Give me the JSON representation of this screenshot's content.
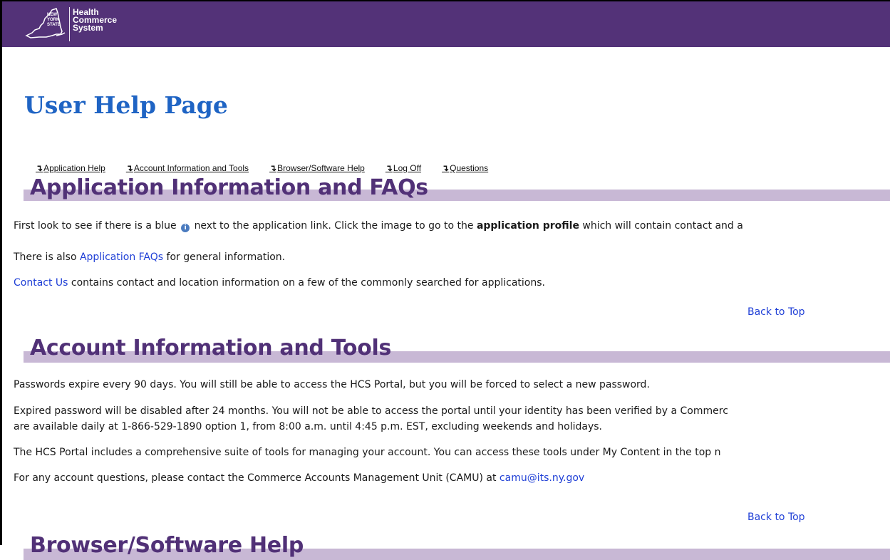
{
  "header": {
    "logo_state_lines": [
      "NEW",
      "YORK",
      "STATE"
    ],
    "logo_text_lines": [
      "Health",
      "Commerce",
      "System"
    ],
    "bg_color": "#533278"
  },
  "page": {
    "title": "User Help Page"
  },
  "tabs": [
    {
      "label": "Application Help"
    },
    {
      "label": "Account Information and Tools"
    },
    {
      "label": "Browser/Software Help"
    },
    {
      "label": "Log Off"
    },
    {
      "label": "Questions"
    }
  ],
  "sections": {
    "app_info": {
      "heading": "Application Information and FAQs",
      "p1_before": "First look to see if there is a blue",
      "p1_middle": "next to the application link. Click the image to go to the",
      "p1_bold": "application profile",
      "p1_after": "which will contain contact and a",
      "p2_before": "There is also",
      "p2_link": "Application FAQs",
      "p2_after": "for general information.",
      "p3_link": "Contact Us",
      "p3_after": "contains contact and location information on a few of the commonly searched for applications.",
      "back_to_top": "Back to Top"
    },
    "account": {
      "heading": "Account Information and Tools",
      "p1": "Passwords expire every 90 days. You will still be able to access the HCS Portal, but you will be forced to select a new password.",
      "p2_line1": "Expired password will be disabled after 24 months. You will not be able to access the portal until your identity has been verified by a Commerc",
      "p2_line2": "are available daily at 1-866-529-1890 option 1, from 8:00 a.m. until 4:45 p.m. EST, excluding weekends and holidays.",
      "p3": "The HCS Portal includes a comprehensive suite of tools for managing your account. You can access these tools under My Content in the top n",
      "p4_before": "For any account questions, please contact the Commerce Accounts Management Unit (CAMU) at",
      "p4_link": "camu@its.ny.gov",
      "back_to_top": "Back to Top"
    },
    "browser": {
      "heading": "Browser/Software Help"
    }
  }
}
